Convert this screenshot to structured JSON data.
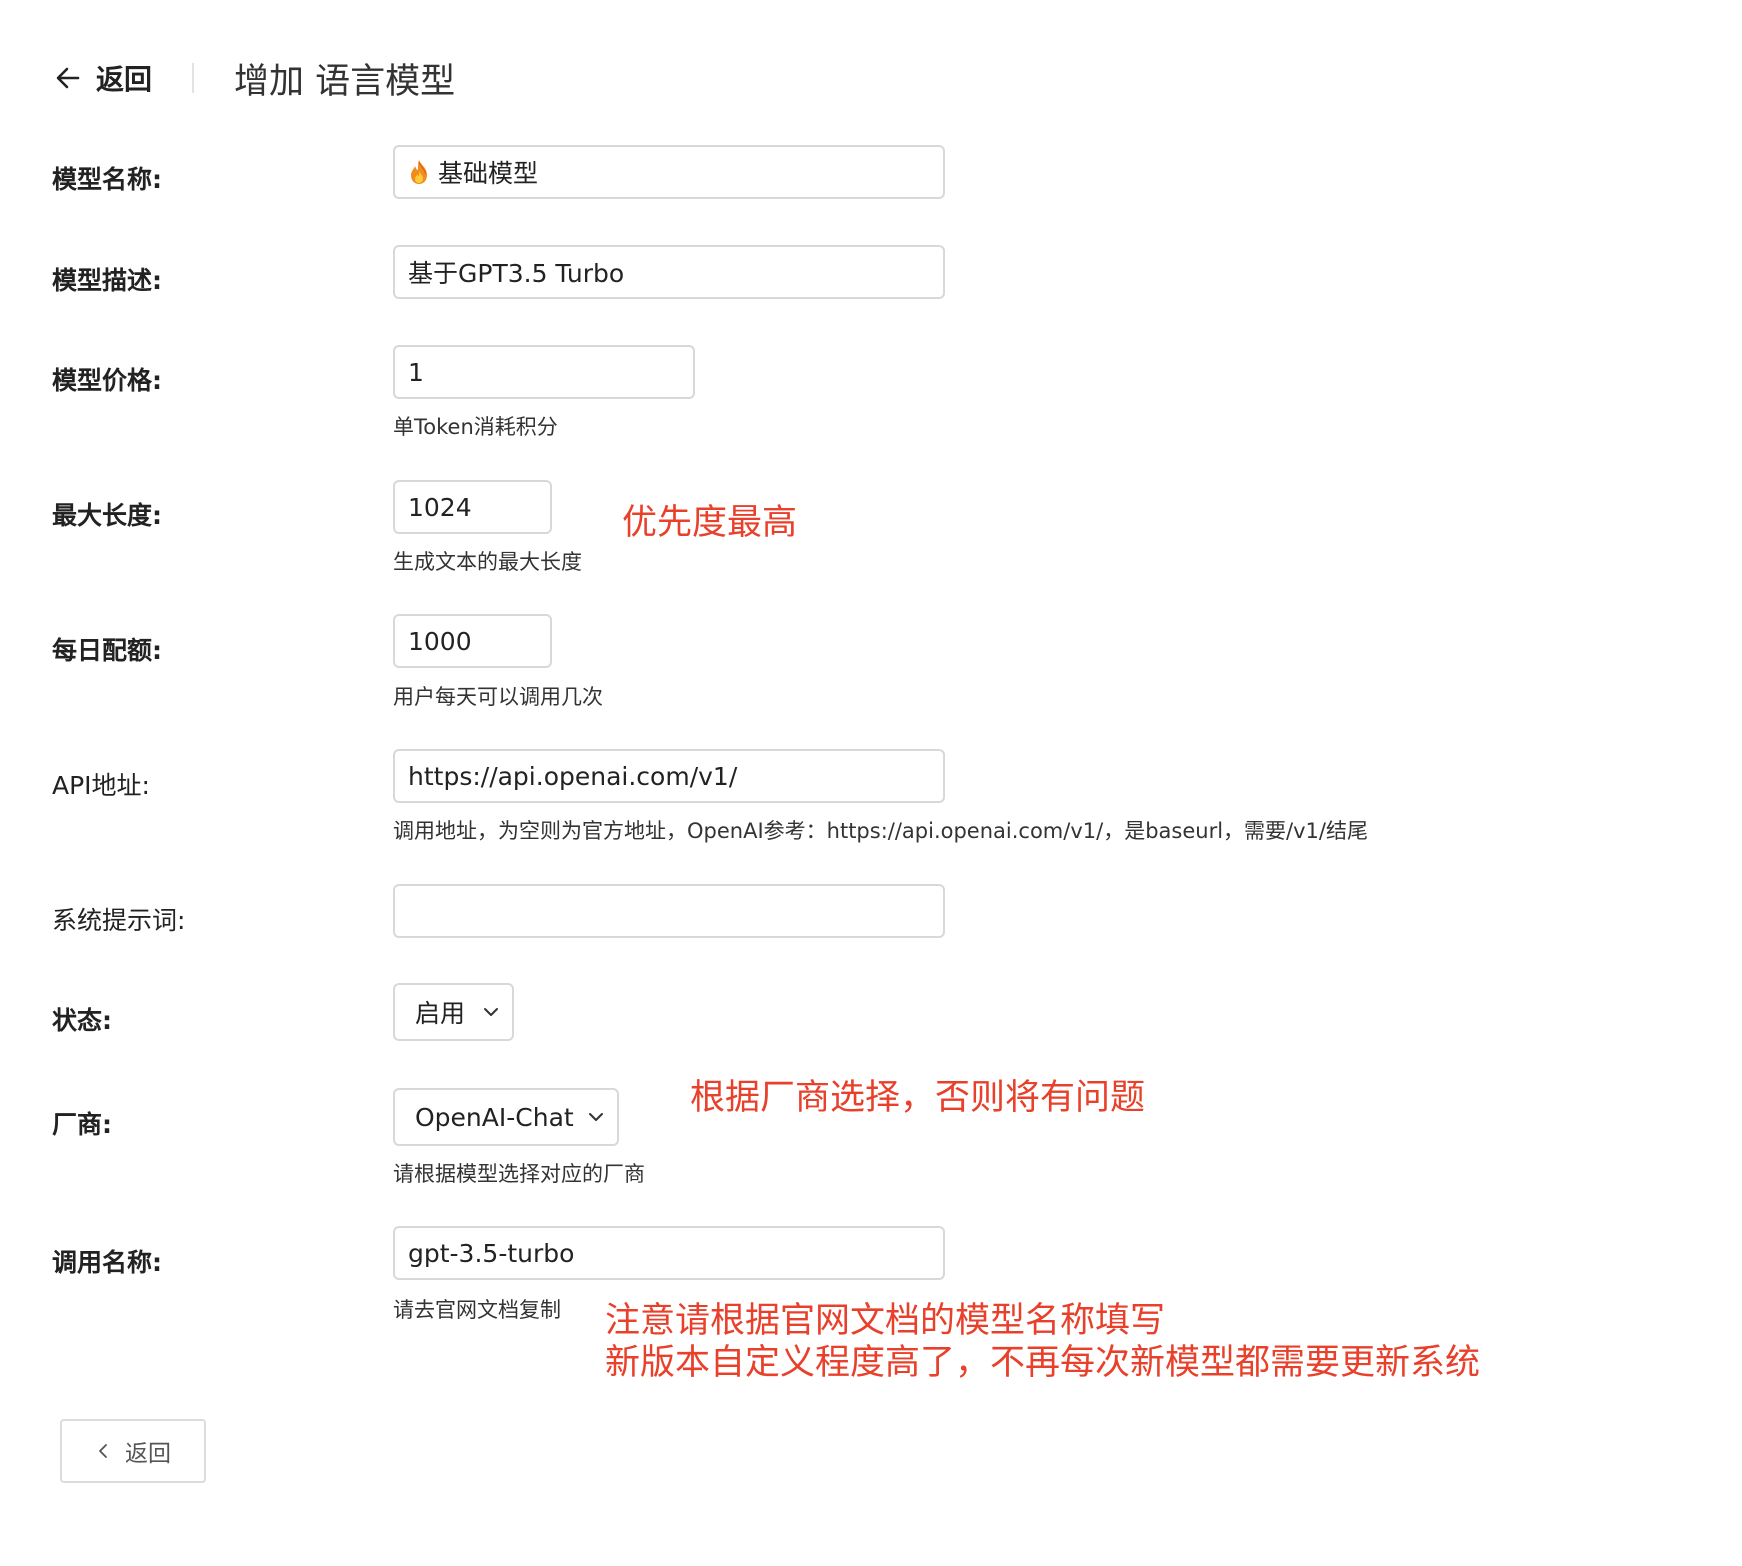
{
  "header": {
    "back_label": "返回",
    "title": "增加 语言模型"
  },
  "form": {
    "name": {
      "label": "模型名称:",
      "value": "基础模型",
      "icon": "fire-icon"
    },
    "description": {
      "label": "模型描述:",
      "value": "基于GPT3.5 Turbo"
    },
    "price": {
      "label": "模型价格:",
      "value": "1",
      "help": "单Token消耗积分"
    },
    "max_length": {
      "label": "最大长度:",
      "value": "1024",
      "help": "生成文本的最大长度"
    },
    "daily_quota": {
      "label": "每日配额:",
      "value": "1000",
      "help": "用户每天可以调用几次"
    },
    "api_url": {
      "label": "API地址:",
      "value": "https://api.openai.com/v1/",
      "help": "调用地址，为空则为官方地址，OpenAI参考：https://api.openai.com/v1/，是baseurl，需要/v1/结尾"
    },
    "system_prompt": {
      "label": "系统提示词:",
      "value": ""
    },
    "status": {
      "label": "状态:",
      "value": "启用"
    },
    "vendor": {
      "label": "厂商:",
      "value": "OpenAI-Chat",
      "help": "请根据模型选择对应的厂商"
    },
    "call_name": {
      "label": "调用名称:",
      "value": "gpt-3.5-turbo",
      "help": "请去官网文档复制"
    }
  },
  "annotations": {
    "priority": "优先度最高",
    "vendor_note": "根据厂商选择，否则将有问题",
    "call_note_line1": "注意请根据官网文档的模型名称填写",
    "call_note_line2": "新版本自定义程度高了，不再每次新模型都需要更新系统"
  },
  "footer": {
    "back_label": "返回"
  },
  "colors": {
    "annotation": "#e8402a",
    "border": "#d8d8d8"
  }
}
